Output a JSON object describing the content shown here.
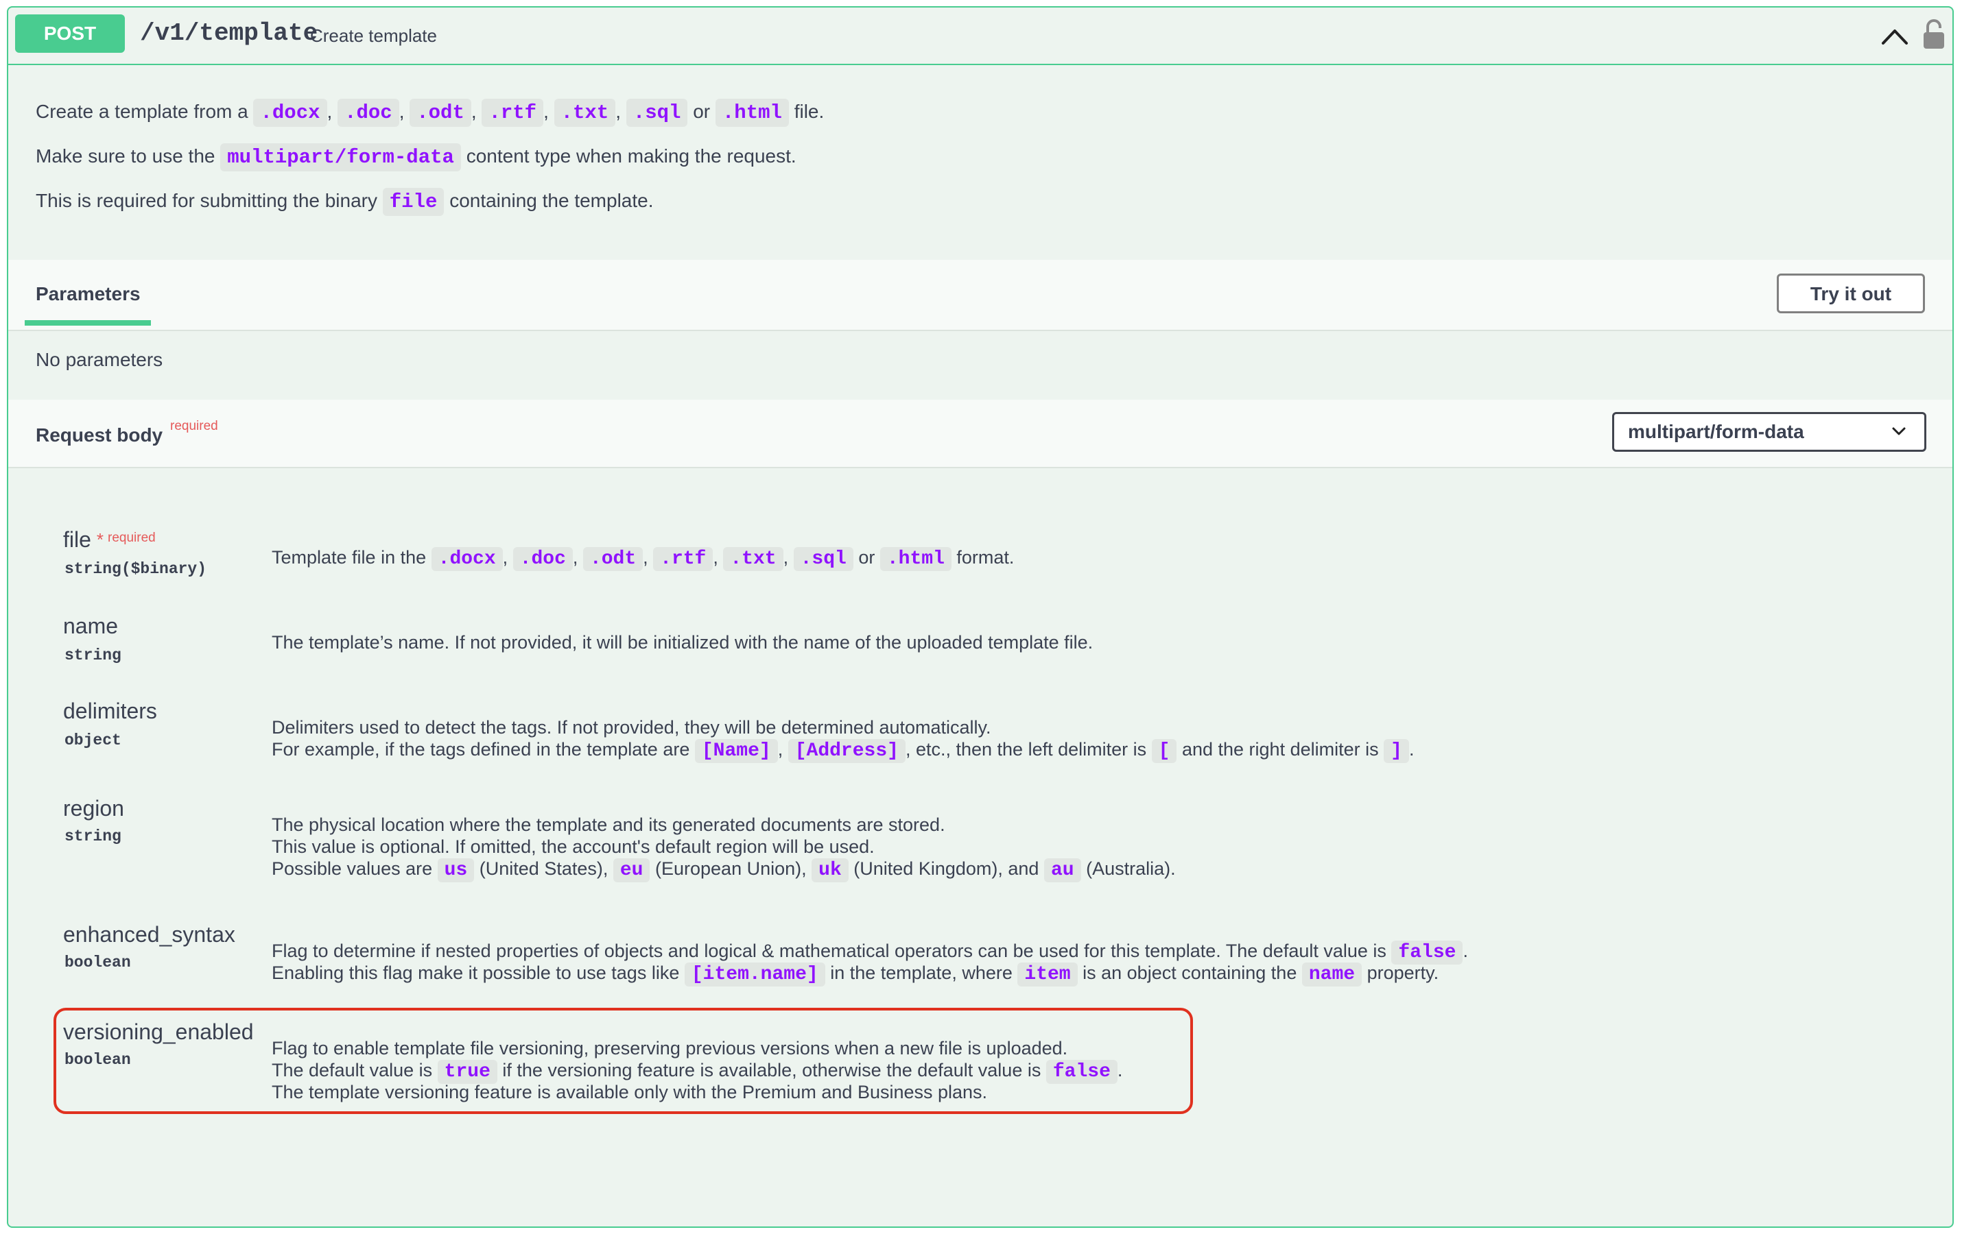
{
  "operation": {
    "method": "POST",
    "path": "/v1/template",
    "summary": "Create template"
  },
  "description": {
    "line1": {
      "prefix": "Create a template from a",
      "formats": [
        ".docx",
        ".doc",
        ".odt",
        ".rtf",
        ".txt",
        ".sql"
      ],
      "or": "or",
      "last_format": ".html",
      "suffix": "file."
    },
    "line2": {
      "prefix": "Make sure to use the",
      "code": "multipart/form-data",
      "suffix": "content type when making the request."
    },
    "line3": {
      "prefix": "This is required for submitting the binary",
      "code": "file",
      "suffix": "containing the template."
    }
  },
  "parameters": {
    "tab_label": "Parameters",
    "try_button": "Try it out",
    "empty_text": "No parameters"
  },
  "request_body": {
    "title": "Request body",
    "required_label": "required",
    "content_type": "multipart/form-data"
  },
  "properties": [
    {
      "name": "file",
      "star": "*",
      "required_label": "required",
      "type": "string($binary)",
      "desc": {
        "prefix": "Template file in the",
        "formats": [
          ".docx",
          ".doc",
          ".odt",
          ".rtf",
          ".txt",
          ".sql"
        ],
        "or": "or",
        "last_format": ".html",
        "suffix": "format."
      }
    },
    {
      "name": "name",
      "type": "string",
      "desc": "The template’s name. If not provided, it will be initialized with the name of the uploaded template file."
    },
    {
      "name": "delimiters",
      "type": "object",
      "desc_line1": "Delimiters used to detect the tags. If not provided, they will be determined automatically.",
      "desc_line2": {
        "t1": "For example, if the tags defined in the template are",
        "c1": "[Name]",
        "c2": "[Address]",
        "t2": ", etc., then the left delimiter is",
        "c3": "[",
        "t3": "and the right delimiter is",
        "c4": "]",
        "t4": "."
      }
    },
    {
      "name": "region",
      "type": "string",
      "desc_line1": "The physical location where the template and its generated documents are stored.",
      "desc_line2": "This value is optional. If omitted, the account's default region will be used.",
      "desc_line3": {
        "t1": "Possible values are",
        "c1": "us",
        "t2": "(United States),",
        "c2": "eu",
        "t3": "(European Union),",
        "c3": "uk",
        "t4": "(United Kingdom), and",
        "c4": "au",
        "t5": "(Australia)."
      }
    },
    {
      "name": "enhanced_syntax",
      "type": "boolean",
      "desc_line1": {
        "t1": "Flag to determine if nested properties of objects and logical & mathematical operators can be used for this template. The default value is",
        "c1": "false",
        "t2": "."
      },
      "desc_line2": {
        "t1": "Enabling this flag make it possible to use tags like",
        "c1": "[item.name]",
        "t2": "in the template, where",
        "c2": "item",
        "t3": "is an object containing the",
        "c3": "name",
        "t4": "property."
      }
    },
    {
      "name": "versioning_enabled",
      "type": "boolean",
      "desc_line1": "Flag to enable template file versioning, preserving previous versions when a new file is uploaded.",
      "desc_line2": {
        "t1": "The default value is",
        "c1": "true",
        "t2": "if the versioning feature is available, otherwise the default value is",
        "c2": "false",
        "t3": "."
      },
      "desc_line3": "The template versioning feature is available only with the Premium and Business plans."
    }
  ],
  "colors": {
    "post_green": "#49cc90",
    "panel_bg": "#edf4ef",
    "code_purple": "#9012fe",
    "required_red": "#e55a5a",
    "highlight_red": "#e0311f"
  },
  "icons": {
    "collapse": "chevron-up-icon",
    "authorization": "lock-icon",
    "dropdown": "chevron-down-icon"
  }
}
